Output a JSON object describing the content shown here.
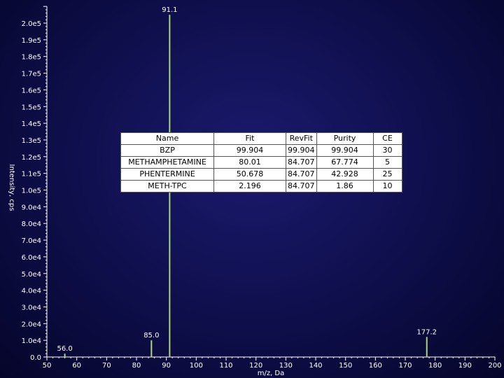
{
  "chart_data": {
    "type": "bar",
    "xlabel": "m/z, Da",
    "ylabel": "Intensity, cps",
    "xlim": [
      50,
      200
    ],
    "ylim": [
      0,
      210000
    ],
    "x_ticks": [
      "50",
      "60",
      "70",
      "80",
      "90",
      "100",
      "110",
      "120",
      "130",
      "140",
      "150",
      "160",
      "170",
      "180",
      "190",
      "200"
    ],
    "y_ticks": [
      "0.0",
      "1.0e4",
      "2.0e4",
      "3.0e4",
      "4.0e4",
      "5.0e4",
      "6.0e4",
      "7.0e4",
      "8.0e4",
      "9.0e4",
      "1.0e5",
      "1.1e5",
      "1.2e5",
      "1.3e5",
      "1.4e5",
      "1.5e5",
      "1.6e5",
      "1.7e5",
      "1.8e5",
      "1.9e5",
      "2.0e5"
    ],
    "peaks": [
      {
        "mz": 56.0,
        "intensity": 2000,
        "label": "56.0"
      },
      {
        "mz": 85.0,
        "intensity": 10000,
        "label": "85.0"
      },
      {
        "mz": 91.1,
        "intensity": 205000,
        "label": "91.1"
      },
      {
        "mz": 177.2,
        "intensity": 12000,
        "label": "177.2"
      }
    ],
    "colors": {
      "peak": "#a8d878",
      "axis": "#ffffff",
      "background": "#0e0e4a"
    }
  },
  "table": {
    "headers": [
      "Name",
      "Fit",
      "RevFit",
      "Purity",
      "CE"
    ],
    "rows": [
      [
        "BZP",
        "99.904",
        "99.904",
        "99.904",
        "30"
      ],
      [
        "METHAMPHETAMINE",
        "80.01",
        "84.707",
        "67.774",
        "5"
      ],
      [
        "PHENTERMINE",
        "50.678",
        "84.707",
        "42.928",
        "25"
      ],
      [
        "METH-TPC",
        "2.196",
        "84.707",
        "1.86",
        "10"
      ]
    ]
  }
}
